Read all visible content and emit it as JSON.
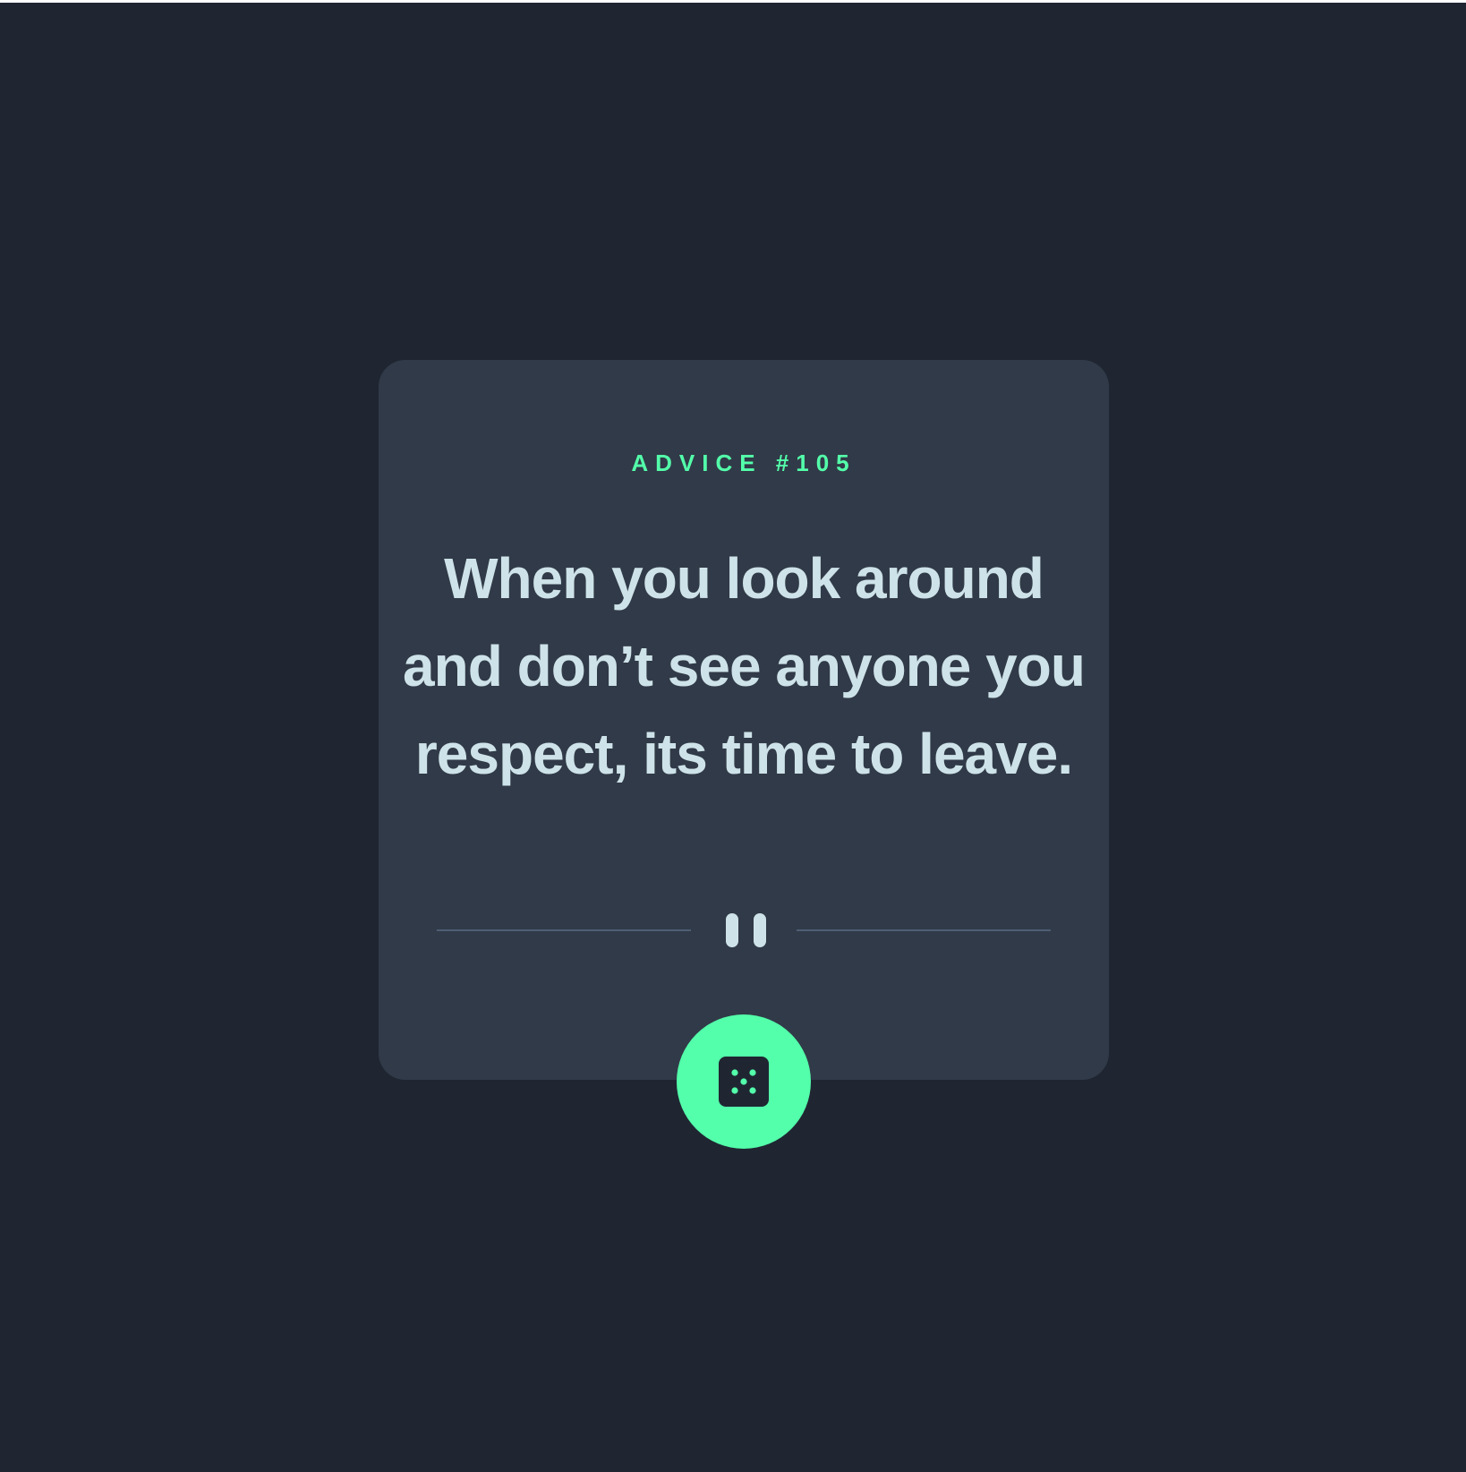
{
  "advice": {
    "label": "ADVICE #105",
    "text": "When you look around and don’t see anyone you respect, its time to leave."
  },
  "divider": {
    "icon": "pause-icon"
  },
  "button": {
    "icon": "dice-icon",
    "aria_label": "Generate new advice"
  },
  "colors": {
    "background": "#1f2632",
    "card": "#313a48",
    "accent": "#53ffaa",
    "text": "#cee3e9",
    "divider": "#4f5d74"
  }
}
